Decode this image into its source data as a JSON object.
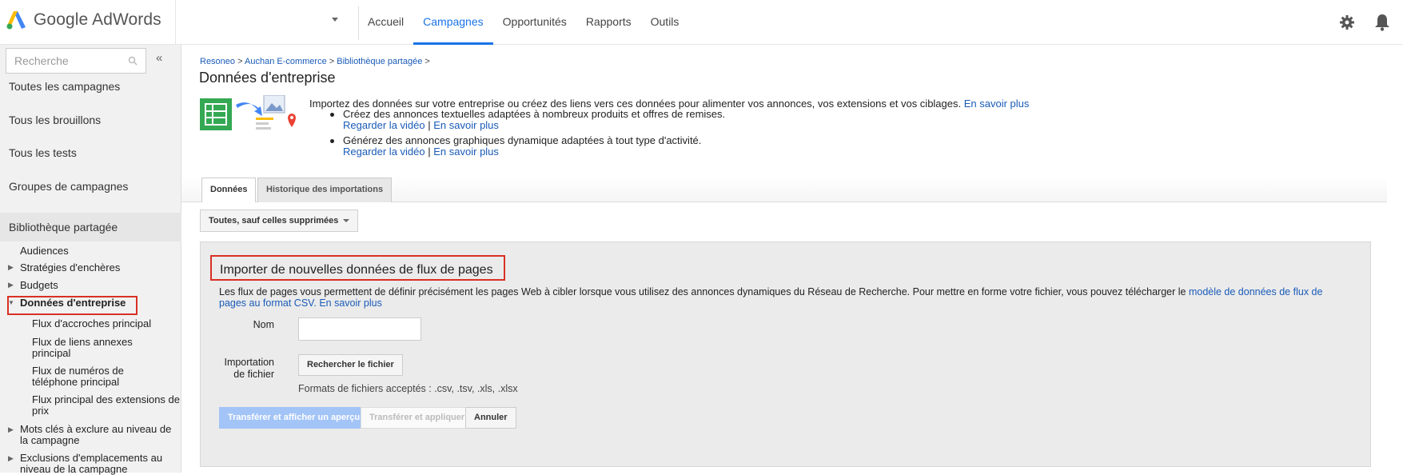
{
  "app": {
    "logo_text": "Google AdWords"
  },
  "nav": {
    "items": [
      "Accueil",
      "Campagnes",
      "Opportunités",
      "Rapports",
      "Outils"
    ],
    "active": "Campagnes"
  },
  "sidebar": {
    "search_placeholder": "Recherche",
    "collapse": "«",
    "main_items": [
      "Toutes les campagnes",
      "Tous les brouillons",
      "Tous les tests",
      "Groupes de campagnes",
      "Bibliothèque partagée"
    ],
    "sub_items": {
      "audiences": "Audiences",
      "bid_strategies": "Stratégies d'enchères",
      "budgets": "Budgets",
      "business_data": "Données d'entreprise",
      "callout_feed": "Flux d'accroches principal",
      "sitelinks_feed": "Flux de liens annexes principal",
      "phone_feed": "Flux de numéros de téléphone principal",
      "price_feed": "Flux principal des extensions de prix",
      "negative_keywords": "Mots clés à exclure au niveau de la campagne",
      "placement_exclusions": "Exclusions d'emplacements au niveau de la campagne"
    }
  },
  "breadcrumb": {
    "items": [
      "Resoneo",
      "Auchan E-commerce",
      "Bibliothèque partagée"
    ],
    "sep": ">"
  },
  "page": {
    "title": "Données d'entreprise",
    "intro": "Importez des données sur votre entreprise ou créez des liens vers ces données pour alimenter vos annonces, vos extensions et vos ciblages.",
    "intro_link": "En savoir plus",
    "bullets": [
      {
        "text": "Créez des annonces textuelles adaptées à nombreux produits et offres de remises.",
        "video": "Regarder la vidéo",
        "sep": "|",
        "more": "En savoir plus"
      },
      {
        "text": "Générez des annonces graphiques dynamique adaptées à tout type d'activité.",
        "video": "Regarder la vidéo",
        "sep": "|",
        "more": "En savoir plus"
      }
    ]
  },
  "tabs": [
    "Données",
    "Historique des importations"
  ],
  "filter": {
    "label": "Toutes, sauf celles supprimées"
  },
  "import_panel": {
    "title": "Importer de nouvelles données de flux de pages",
    "desc": "Les flux de pages vous permettent de définir précisément les pages Web à cibler lorsque vous utilisez des annonces dynamiques du Réseau de Recherche. Pour mettre en forme votre fichier, vous pouvez télécharger le",
    "desc_link1": "modèle de données de flux de pages au format CSV.",
    "desc_link2": "En savoir plus",
    "name_label": "Nom",
    "file_label_1": "Importation",
    "file_label_2": "de fichier",
    "browse_button": "Rechercher le fichier",
    "formats": "Formats de fichiers acceptés : .csv, .tsv, .xls, .xlsx",
    "btn_preview": "Transférer et afficher un aperçu",
    "btn_apply": "Transférer et appliquer",
    "btn_cancel": "Annuler"
  },
  "colors": {
    "accent": "#1a73e8",
    "link": "#1a5bb8",
    "highlight": "#d93025"
  }
}
